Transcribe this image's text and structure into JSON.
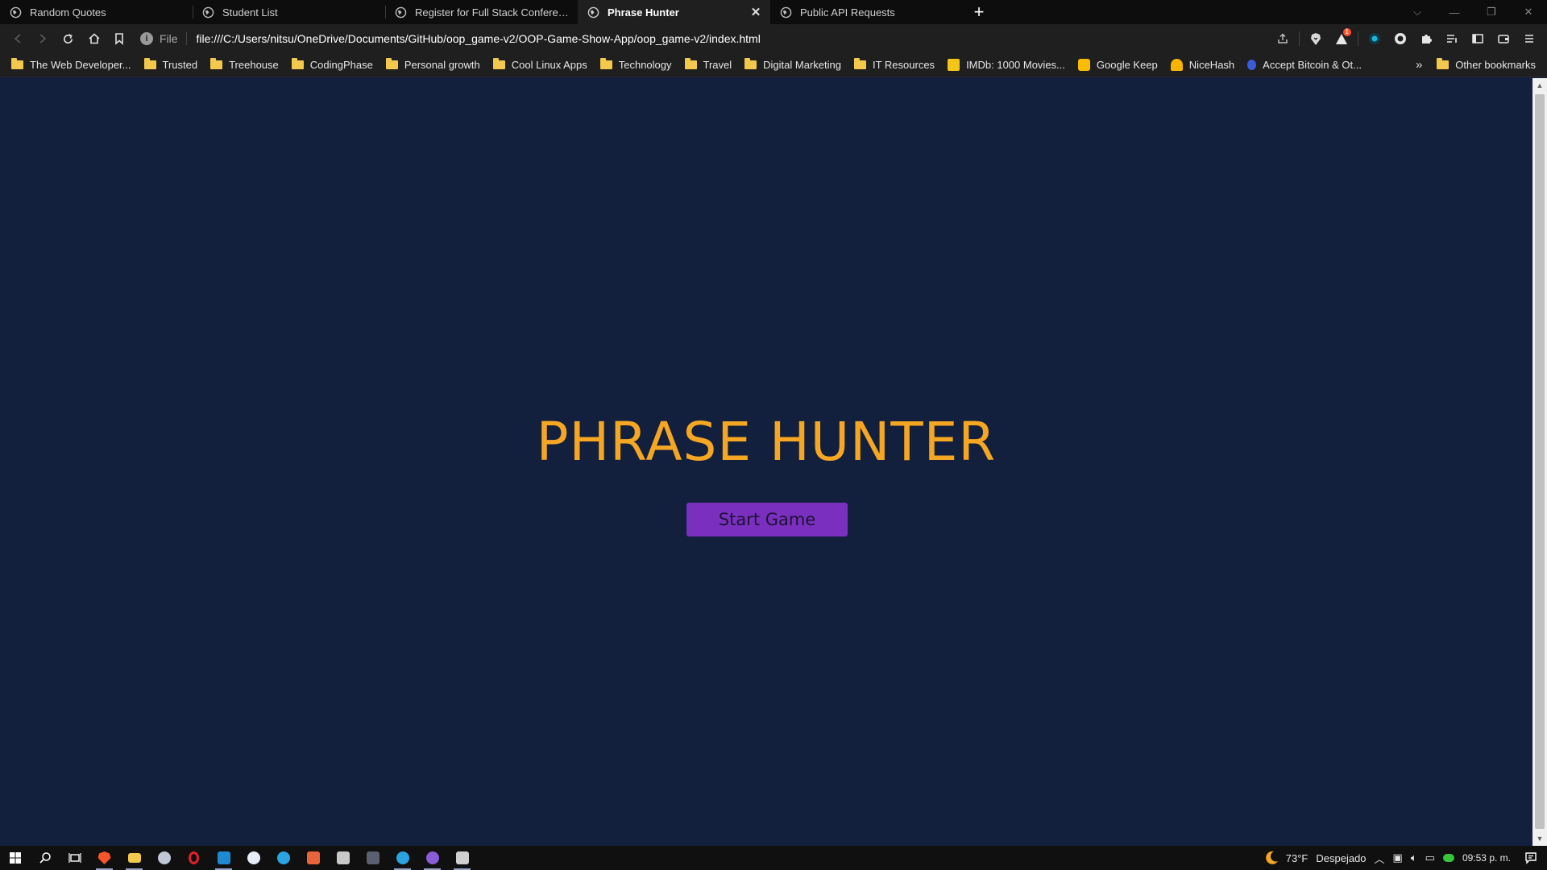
{
  "browser": {
    "tabs": [
      {
        "title": "Random Quotes",
        "active": false
      },
      {
        "title": "Student List",
        "active": false
      },
      {
        "title": "Register for Full Stack Conference",
        "active": false
      },
      {
        "title": "Phrase Hunter",
        "active": true
      },
      {
        "title": "Public API Requests",
        "active": false
      }
    ],
    "new_tab_label": "+",
    "address": {
      "scheme_label": "File",
      "url": "file:///C:/Users/nitsu/OneDrive/Documents/GitHub/oop_game-v2/OOP-Game-Show-App/oop_game-v2/index.html"
    },
    "brave_rewards_count": "1",
    "bookmarks": [
      {
        "label": "The Web Developer...",
        "icon": "folder-icon"
      },
      {
        "label": "Trusted",
        "icon": "folder-icon"
      },
      {
        "label": "Treehouse",
        "icon": "folder-icon"
      },
      {
        "label": "CodingPhase",
        "icon": "folder-icon"
      },
      {
        "label": "Personal growth",
        "icon": "folder-icon"
      },
      {
        "label": "Cool Linux Apps",
        "icon": "folder-icon"
      },
      {
        "label": "Technology",
        "icon": "folder-icon"
      },
      {
        "label": "Travel",
        "icon": "folder-icon"
      },
      {
        "label": "Digital Marketing",
        "icon": "folder-icon"
      },
      {
        "label": "IT Resources",
        "icon": "folder-icon"
      },
      {
        "label": "IMDb: 1000 Movies...",
        "icon": "imdb-icon"
      },
      {
        "label": "Google Keep",
        "icon": "google-keep-icon"
      },
      {
        "label": "NiceHash",
        "icon": "nicehash-icon"
      },
      {
        "label": "Accept Bitcoin & Ot...",
        "icon": "bitcoin-icon"
      }
    ],
    "bookmarks_overflow": "»",
    "other_bookmarks": "Other bookmarks"
  },
  "page": {
    "title": "PHRASE HUNTER",
    "start_button": "Start Game"
  },
  "taskbar": {
    "weather_temp": "73°F",
    "weather_desc": "Despejado",
    "clock": "09:53 p. m."
  },
  "colors": {
    "page_background": "#121f3d",
    "title_orange": "#f5a623",
    "button_purple": "#7b2fbf",
    "chrome_dark": "#1f1f1f"
  }
}
